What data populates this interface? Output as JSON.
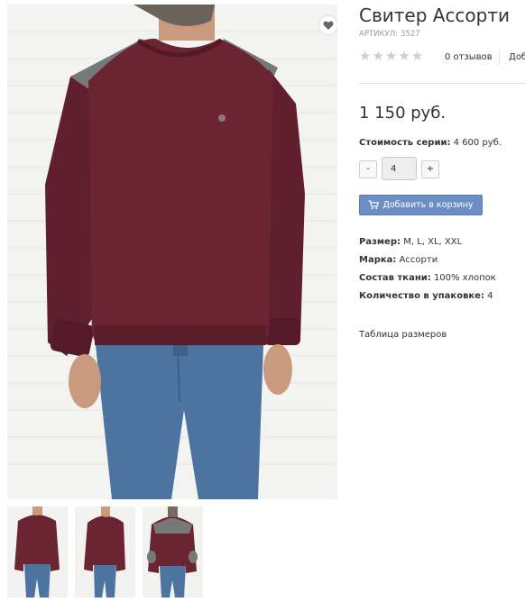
{
  "product": {
    "title": "Свитер Ассорти",
    "article_label": "АРТИКУЛ:",
    "article_value": "3527",
    "rating": 0,
    "reviews_text": "0 отзывов",
    "add_review_text": "Доб",
    "price": "1 150 руб.",
    "series_label": "Стоимость серии:",
    "series_value": "4 600 руб.",
    "quantity": {
      "minus_label": "-",
      "value": "4",
      "plus_label": "+"
    },
    "add_to_cart_label": "Добавить в корзину",
    "properties": [
      {
        "label": "Размер:",
        "value": "M, L, XL, XXL"
      },
      {
        "label": "Марка:",
        "value": "Ассорти"
      },
      {
        "label": "Состав ткани:",
        "value": "100% хлопок"
      },
      {
        "label": "Количество в упаковке:",
        "value": "4"
      }
    ],
    "size_table_link": "Таблица размеров"
  },
  "colors": {
    "sweater": "#6b2532",
    "jeans": "#4d74a0",
    "shoulder_patch": "#7a7a7a",
    "button_blue": "#6b8fc4",
    "star_empty": "#cfcfcf"
  },
  "icons": {
    "favorite": "heart-icon",
    "cart": "cart-icon",
    "rating": "star-icon"
  }
}
